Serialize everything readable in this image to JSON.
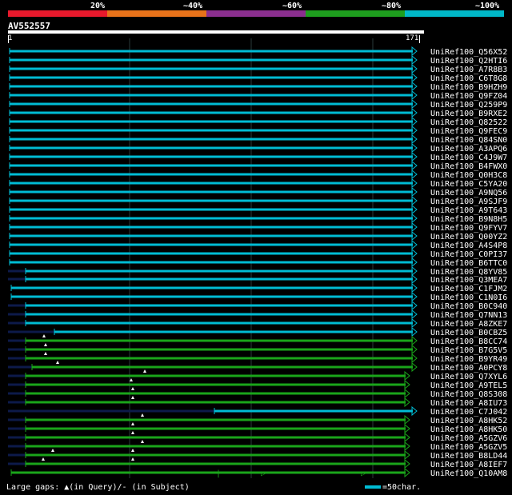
{
  "scale": {
    "labels": [
      "20%",
      "~40%",
      "~60%",
      "~80%",
      "~100%"
    ],
    "colors": [
      "#e8192c",
      "#e8721a",
      "#8b2f8f",
      "#1e9e1e",
      "#00b8c8"
    ]
  },
  "query": {
    "id": "AV552557",
    "start": "1",
    "end": "171"
  },
  "colors": {
    "teal": "#00bcd4",
    "green": "#1aa51a",
    "grid": "#2a3a3a",
    "stub": "#0d1a4a"
  },
  "hits": [
    {
      "name": "UniRef100_Q56X52",
      "c": "teal"
    },
    {
      "name": "UniRef100_Q2HTI6",
      "c": "teal"
    },
    {
      "name": "UniRef100_A7R8B3",
      "c": "teal"
    },
    {
      "name": "UniRef100_C6T8G8",
      "c": "teal"
    },
    {
      "name": "UniRef100_B9HZH9",
      "c": "teal"
    },
    {
      "name": "UniRef100_Q9FZ04",
      "c": "teal"
    },
    {
      "name": "UniRef100_Q259P9",
      "c": "teal"
    },
    {
      "name": "UniRef100_B9RXE2",
      "c": "teal"
    },
    {
      "name": "UniRef100_Q82522",
      "c": "teal"
    },
    {
      "name": "UniRef100_Q9FEC9",
      "c": "teal"
    },
    {
      "name": "UniRef100_Q84SN0",
      "c": "teal"
    },
    {
      "name": "UniRef100_A3APQ6",
      "c": "teal"
    },
    {
      "name": "UniRef100_C4J9W7",
      "c": "teal"
    },
    {
      "name": "UniRef100_B4FWX0",
      "c": "teal"
    },
    {
      "name": "UniRef100_Q0H3C8",
      "c": "teal"
    },
    {
      "name": "UniRef100_C5YA20",
      "c": "teal"
    },
    {
      "name": "UniRef100_A9NQ56",
      "c": "teal"
    },
    {
      "name": "UniRef100_A9SJF9",
      "c": "teal"
    },
    {
      "name": "UniRef100_A9T643",
      "c": "teal"
    },
    {
      "name": "UniRef100_B9N8H5",
      "c": "teal"
    },
    {
      "name": "UniRef100_Q9FYV7",
      "c": "teal"
    },
    {
      "name": "UniRef100_Q00YZ2",
      "c": "teal"
    },
    {
      "name": "UniRef100_A4S4P8",
      "c": "teal"
    },
    {
      "name": "UniRef100_C0PI37",
      "c": "teal"
    },
    {
      "name": "UniRef100_B6TTC0",
      "c": "teal"
    },
    {
      "name": "UniRef100_Q8YV85",
      "c": "teal"
    },
    {
      "name": "UniRef100_Q3MEA7",
      "c": "teal"
    },
    {
      "name": "UniRef100_C1FJM2",
      "c": "teal"
    },
    {
      "name": "UniRef100_C1N0I6",
      "c": "teal"
    },
    {
      "name": "UniRef100_B0C940",
      "c": "teal"
    },
    {
      "name": "UniRef100_Q7NN13",
      "c": "teal"
    },
    {
      "name": "UniRef100_A8ZKE7",
      "c": "teal"
    },
    {
      "name": "UniRef100_B0CBZ5",
      "c": "teal"
    },
    {
      "name": "UniRef100_B8CC74",
      "c": "green"
    },
    {
      "name": "UniRef100_B7G5V5",
      "c": "green"
    },
    {
      "name": "UniRef100_B9YR49",
      "c": "green"
    },
    {
      "name": "UniRef100_A0PCY8",
      "c": "green"
    },
    {
      "name": "UniRef100_Q7XYL6",
      "c": "green"
    },
    {
      "name": "UniRef100_A9TEL5",
      "c": "green"
    },
    {
      "name": "UniRef100_Q8S308",
      "c": "green"
    },
    {
      "name": "UniRef100_A8IU73",
      "c": "green"
    },
    {
      "name": "UniRef100_C7J042",
      "c": "teal"
    },
    {
      "name": "UniRef100_A8HK52",
      "c": "green"
    },
    {
      "name": "UniRef100_A8HK50",
      "c": "green"
    },
    {
      "name": "UniRef100_A5GZV6",
      "c": "green"
    },
    {
      "name": "UniRef100_A5GZV5",
      "c": "green"
    },
    {
      "name": "UniRef100_B8LD44",
      "c": "green"
    },
    {
      "name": "UniRef100_A8IEF7",
      "c": "green"
    },
    {
      "name": "UniRef100_Q10AM8",
      "c": "green"
    }
  ],
  "footer": {
    "gaps_text": "Large gaps: ▲(in Query)/- (in Subject)",
    "legend_text": "=50char."
  }
}
